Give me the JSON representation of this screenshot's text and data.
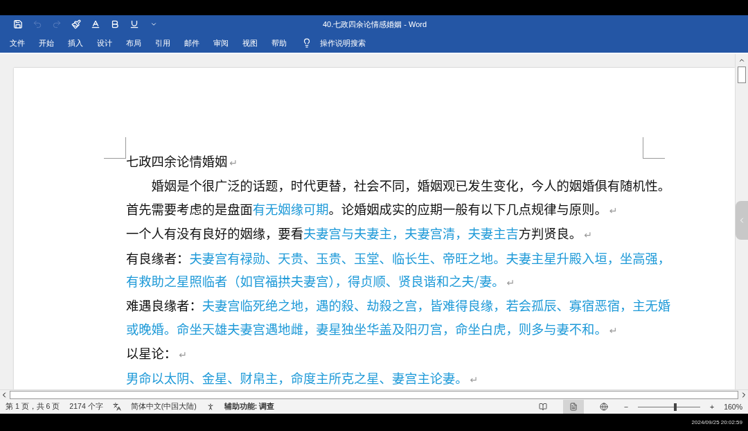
{
  "window": {
    "title": "40.七政四余论情感婚姻 - Word"
  },
  "quick_access": [
    {
      "disabled": false
    },
    {
      "disabled": true
    },
    {
      "disabled": true
    },
    {
      "disabled": false
    },
    {
      "disabled": false
    },
    {
      "disabled": false
    },
    {
      "disabled": false
    },
    {
      "disabled": false
    }
  ],
  "ribbon_tabs": [
    {
      "label": "文件",
      "selected": false
    },
    {
      "label": "开始",
      "selected": false
    },
    {
      "label": "插入",
      "selected": false
    },
    {
      "label": "设计",
      "selected": false
    },
    {
      "label": "布局",
      "selected": false
    },
    {
      "label": "引用",
      "selected": false
    },
    {
      "label": "邮件",
      "selected": false
    },
    {
      "label": "审阅",
      "selected": false
    },
    {
      "label": "视图",
      "selected": false
    },
    {
      "label": "帮助",
      "selected": false
    }
  ],
  "search": {
    "placeholder": "操作说明搜索"
  },
  "document": {
    "paragraphs": [
      {
        "indent": false,
        "end_mark": "↵",
        "segments": [
          {
            "text": "七政四余论情婚姻",
            "highlight": false
          }
        ]
      },
      {
        "indent": true,
        "end_mark": "↵",
        "segments": [
          {
            "text": "婚姻是个很广泛的话题，时代更替，社会不同，婚姻观已发生变化，今人的姻婚俱有随机性。首先需要考虑的是盘面",
            "highlight": false
          },
          {
            "text": "有无姻缘可期",
            "highlight": true
          },
          {
            "text": "。论婚姻成实的应期一般有以下几点规律与原则。",
            "highlight": false
          }
        ]
      },
      {
        "indent": false,
        "end_mark": "↵",
        "segments": [
          {
            "text": "一个人有没有良好的姻缘，要看",
            "highlight": false
          },
          {
            "text": "夫妻宫与夫妻主，夫妻宫清，夫妻主吉",
            "highlight": true
          },
          {
            "text": "方判贤良。",
            "highlight": false
          }
        ]
      },
      {
        "indent": false,
        "end_mark": "↵",
        "segments": [
          {
            "text": "有良缘者：",
            "highlight": false
          },
          {
            "text": "夫妻宫有禄勋、天贵、玉贵、玉堂、临长生、帝旺之地。夫妻主星升殿入垣，坐高强，有救助之星照临者（如官福拱夫妻宫），得贞顺、贤良谐和之夫/妻。",
            "highlight": true
          }
        ]
      },
      {
        "indent": false,
        "end_mark": "↵",
        "segments": [
          {
            "text": "难遇良缘者：",
            "highlight": false
          },
          {
            "text": "夫妻宫临死绝之地，遇的殺、劫殺之宫，皆难得良缘，若会孤辰、寡宿恶宿，主无婚或晚婚。命坐天雄夫妻宫遇地雌，妻星独坐华盖及阳刃宫，命坐白虎，则多与妻不和。",
            "highlight": true
          }
        ]
      },
      {
        "indent": false,
        "end_mark": "↵",
        "segments": [
          {
            "text": "以星论：",
            "highlight": false
          }
        ]
      },
      {
        "indent": false,
        "end_mark": "↵",
        "segments": [
          {
            "text": "男命以太阴、金星、财帛主，命度主所克之星、妻宫主论妻。",
            "highlight": true
          }
        ]
      }
    ]
  },
  "status_bar": {
    "page": "第 1 页，共 6 页",
    "words": "2174 个字",
    "language": "简体中文(中国大陆)",
    "accessibility": "辅助功能: 调查",
    "views": [
      {
        "selected": false
      },
      {
        "selected": true
      },
      {
        "selected": false
      }
    ],
    "zoom_minus": "−",
    "zoom_plus": "+",
    "zoom": {
      "level": 0.6
    },
    "zoom_label": "160%"
  },
  "timestamp": "2024/09/25 20:02:59"
}
